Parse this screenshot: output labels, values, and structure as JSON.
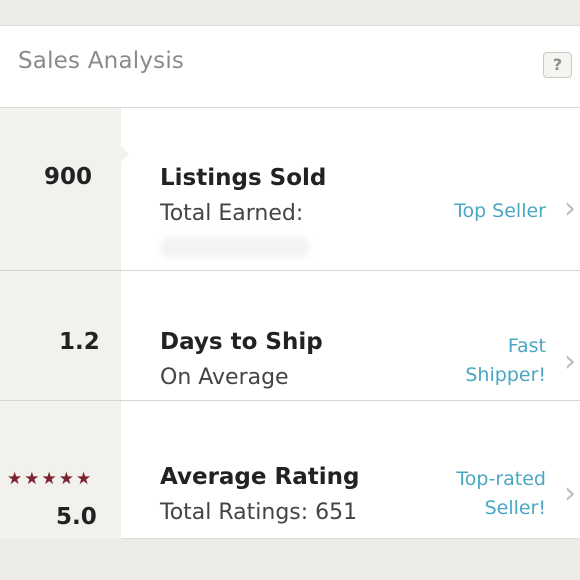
{
  "header": {
    "title": "Sales Analysis",
    "help_label": "?"
  },
  "rows": [
    {
      "metric": "900",
      "title": "Listings Sold",
      "subtitle": "Total Earned:",
      "badge_lines": [
        "Top Seller"
      ]
    },
    {
      "metric": "1.2",
      "title": "Days to Ship",
      "subtitle": "On Average",
      "badge_lines": [
        "Fast",
        "Shipper!"
      ]
    },
    {
      "metric": "5.0",
      "stars": "★★★★★",
      "title": "Average Rating",
      "subtitle": "Total Ratings: 651",
      "badge_lines": [
        "Top-rated",
        "Seller!"
      ]
    }
  ],
  "icons": {
    "chevron": "chevron-right-icon",
    "help": "question-icon"
  },
  "colors": {
    "accent": "#4aa7c4",
    "star": "#7a2430",
    "background": "#ecebe7"
  }
}
